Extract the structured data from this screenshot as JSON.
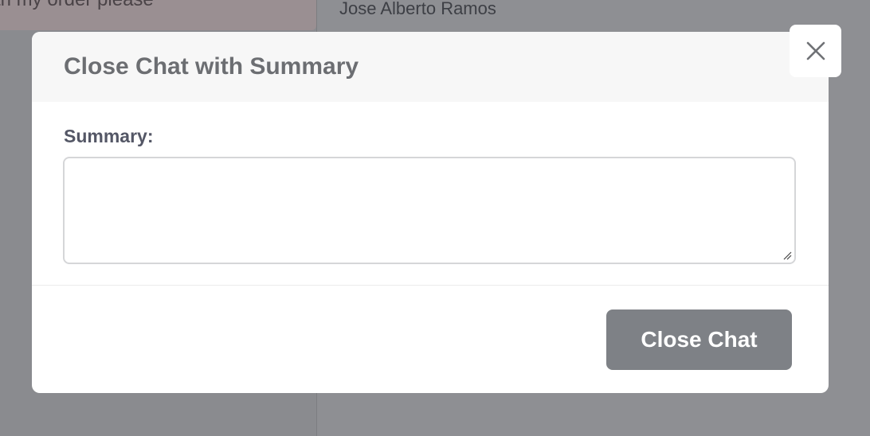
{
  "background": {
    "message_text": "th my order please",
    "contact_name": "Jose Alberto Ramos"
  },
  "modal": {
    "title": "Close Chat with Summary",
    "summary_label": "Summary:",
    "summary_value": "",
    "submit_label": "Close Chat",
    "close_icon": "close-icon"
  },
  "colors": {
    "overlay": "#8e8f93",
    "header_bg": "#f7f7f7",
    "button_bg": "#7e8186",
    "title_text": "#6c6e72"
  }
}
